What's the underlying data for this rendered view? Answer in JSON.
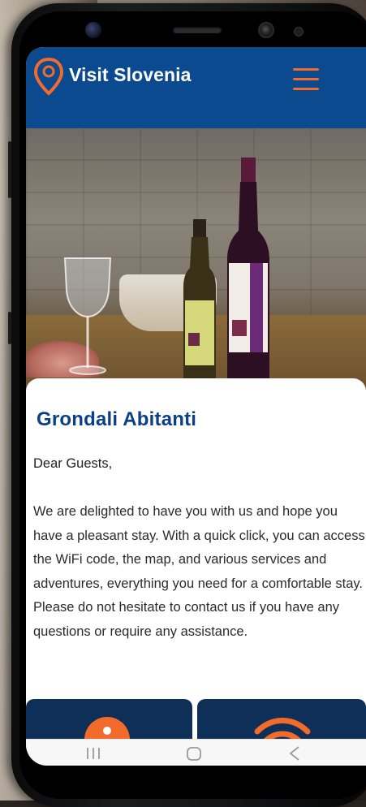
{
  "app": {
    "brand": "Visit Slovenia",
    "accent_color": "#f06b2f",
    "header_color": "#0b4a8f",
    "title_color": "#0b3f86",
    "tile_color": "#0e2f57"
  },
  "hero": {
    "description_icon": "wine-photo"
  },
  "content": {
    "title": "Grondali Abitanti",
    "greeting": "Dear Guests,",
    "paragraph": "We are delighted to have you with us and hope you have a pleasant stay. With a quick click, you can access the WiFi code, the map, and various services and adventures, everything you need for a comfortable stay. Please do not hesitate to contact us if you have any questions or require any assistance."
  },
  "tiles": [
    {
      "icon": "info-icon"
    },
    {
      "icon": "wifi-icon"
    }
  ],
  "navbar": {
    "items": [
      {
        "icon": "recent-apps-icon"
      },
      {
        "icon": "home-icon"
      },
      {
        "icon": "back-icon"
      }
    ]
  }
}
